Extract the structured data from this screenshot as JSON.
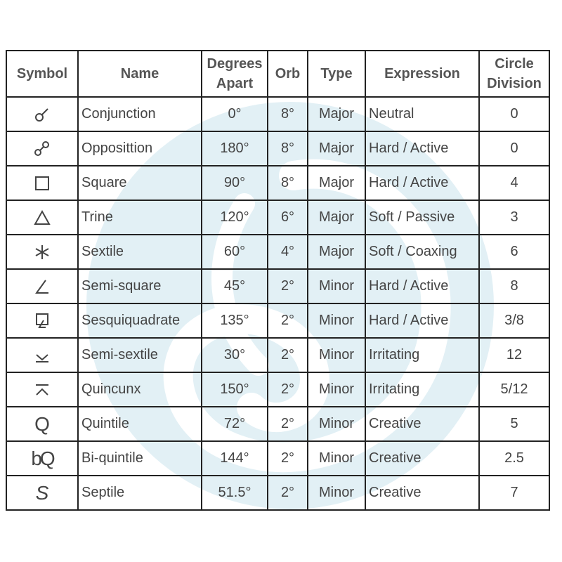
{
  "table": {
    "headers": {
      "symbol": "Symbol",
      "name": "Name",
      "degrees": [
        "Degrees",
        "Apart"
      ],
      "orb": "Orb",
      "type": "Type",
      "expression": "Expression",
      "division": [
        "Circle",
        "Division"
      ]
    },
    "rows": [
      {
        "icon": "conjunction-icon",
        "name": "Conjunction",
        "degrees": "0°",
        "orb": "8°",
        "type": "Major",
        "expression": "Neutral",
        "division": "0"
      },
      {
        "icon": "opposition-icon",
        "name": "Opposittion",
        "degrees": "180°",
        "orb": "8°",
        "type": "Major",
        "expression": "Hard / Active",
        "division": "0"
      },
      {
        "icon": "square-icon",
        "name": "Square",
        "degrees": "90°",
        "orb": "8°",
        "type": "Major",
        "expression": "Hard / Active",
        "division": "4"
      },
      {
        "icon": "trine-icon",
        "name": "Trine",
        "degrees": "120°",
        "orb": "6°",
        "type": "Major",
        "expression": "Soft / Passive",
        "division": "3"
      },
      {
        "icon": "sextile-icon",
        "name": "Sextile",
        "degrees": "60°",
        "orb": "4°",
        "type": "Major",
        "expression": "Soft / Coaxing",
        "division": "6"
      },
      {
        "icon": "semi-square-icon",
        "name": "Semi-square",
        "degrees": "45°",
        "orb": "2°",
        "type": "Minor",
        "expression": "Hard / Active",
        "division": "8"
      },
      {
        "icon": "sesquiquadrate-icon",
        "name": "Sesquiquadrate",
        "degrees": "135°",
        "orb": "2°",
        "type": "Minor",
        "expression": "Hard / Active",
        "division": "3/8"
      },
      {
        "icon": "semi-sextile-icon",
        "name": "Semi-sextile",
        "degrees": "30°",
        "orb": "2°",
        "type": "Minor",
        "expression": "Irritating",
        "division": "12"
      },
      {
        "icon": "quincunx-icon",
        "name": "Quincunx",
        "degrees": "150°",
        "orb": "2°",
        "type": "Minor",
        "expression": "Irritating",
        "division": "5/12"
      },
      {
        "icon": "quintile-icon",
        "name": "Quintile",
        "degrees": "72°",
        "orb": "2°",
        "type": "Minor",
        "expression": "Creative",
        "division": "5"
      },
      {
        "icon": "bi-quintile-icon",
        "name": "Bi-quintile",
        "degrees": "144°",
        "orb": "2°",
        "type": "Minor",
        "expression": "Creative",
        "division": "2.5"
      },
      {
        "icon": "septile-icon",
        "name": "Septile",
        "degrees": "51.5°",
        "orb": "2°",
        "type": "Minor",
        "expression": "Creative",
        "division": "7"
      }
    ],
    "symbol_glyphs": {
      "quintile": "Q",
      "bi_quintile": "bQ",
      "septile": "S"
    }
  },
  "colors": {
    "watermark": "#dcedf3",
    "border": "#222222",
    "text": "#444444"
  }
}
